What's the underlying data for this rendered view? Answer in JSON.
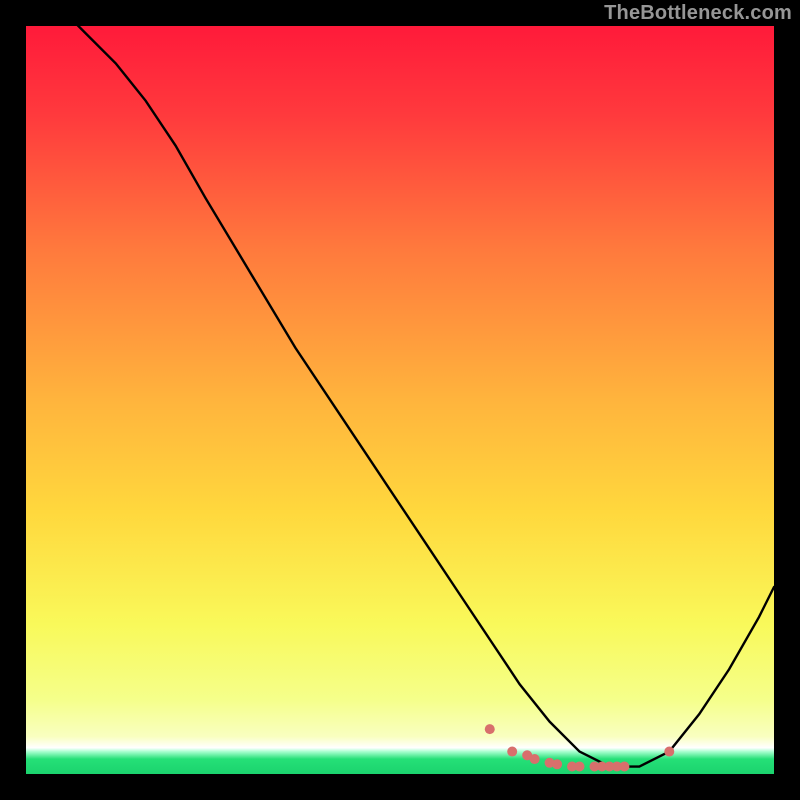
{
  "watermark": "TheBottleneck.com",
  "colors": {
    "background": "#000000",
    "curve": "#000000",
    "markers": "#d86f6c",
    "gradient_top": "#ff1a3a",
    "gradient_mid1": "#ff7a3d",
    "gradient_mid2": "#ffd83d",
    "gradient_mid3": "#f5ff6a",
    "gradient_bottom_yellow": "#fbffb0",
    "gradient_green": "#25e077"
  },
  "chart_data": {
    "type": "line",
    "title": "",
    "xlabel": "",
    "ylabel": "",
    "xlim": [
      0,
      100
    ],
    "ylim": [
      0,
      100
    ],
    "grid": false,
    "legend": false,
    "series": [
      {
        "name": "curve",
        "x": [
          0,
          4,
          8,
          12,
          16,
          20,
          24,
          30,
          36,
          42,
          48,
          54,
          58,
          62,
          66,
          70,
          74,
          78,
          82,
          86,
          90,
          94,
          98,
          100
        ],
        "values": [
          106,
          103,
          99,
          95,
          90,
          84,
          77,
          67,
          57,
          48,
          39,
          30,
          24,
          18,
          12,
          7,
          3,
          1,
          1,
          3,
          8,
          14,
          21,
          25
        ]
      }
    ],
    "markers": {
      "name": "valley-points",
      "x": [
        62,
        65,
        67,
        68,
        70,
        71,
        73,
        74,
        76,
        77,
        78,
        79,
        80,
        86
      ],
      "values": [
        6,
        3,
        2.5,
        2,
        1.5,
        1.3,
        1,
        1,
        1,
        1,
        1,
        1,
        1,
        3
      ]
    }
  }
}
